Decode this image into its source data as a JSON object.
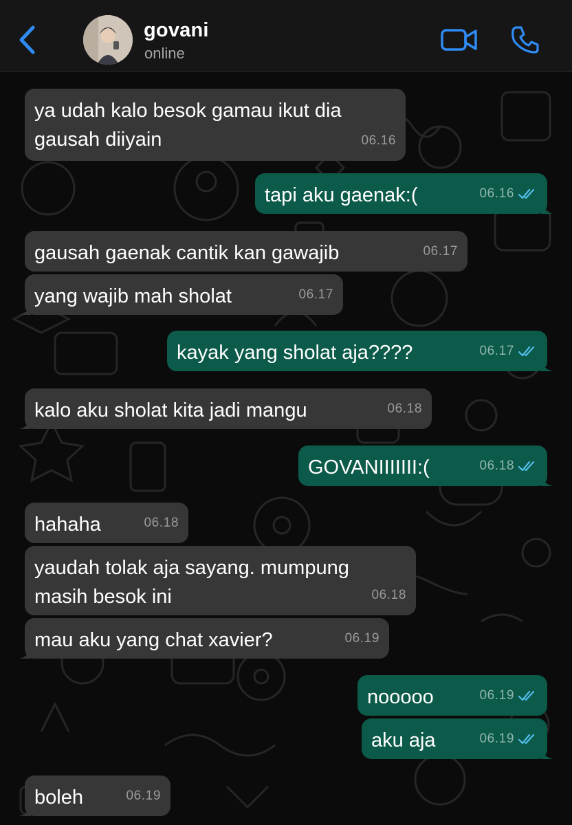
{
  "header": {
    "name": "govani",
    "status": "online"
  },
  "colors": {
    "accent": "#2f8cf5",
    "incoming_bubble": "#373737",
    "outgoing_bubble": "#0c5a49",
    "read_ticks": "#53bdeb"
  },
  "icons": {
    "back": "chevron-left-icon",
    "video": "video-camera-icon",
    "call": "phone-icon",
    "read": "double-check-icon"
  },
  "messages": [
    {
      "dir": "in",
      "lines": [
        "ya udah kalo besok gamau ikut dia",
        "gausah diiyain"
      ],
      "time": "06.16"
    },
    {
      "dir": "out",
      "lines": [
        "tapi aku gaenak:("
      ],
      "time": "06.16",
      "read": true
    },
    {
      "dir": "in",
      "lines": [
        "gausah gaenak cantik kan gawajib"
      ],
      "time": "06.17"
    },
    {
      "dir": "in",
      "lines": [
        "yang wajib mah sholat"
      ],
      "time": "06.17"
    },
    {
      "dir": "out",
      "lines": [
        "kayak yang sholat aja????"
      ],
      "time": "06.17",
      "read": true
    },
    {
      "dir": "in",
      "lines": [
        "kalo aku sholat kita jadi mangu"
      ],
      "time": "06.18"
    },
    {
      "dir": "out",
      "lines": [
        "GOVANIIIIIII:("
      ],
      "time": "06.18",
      "read": true
    },
    {
      "dir": "in",
      "lines": [
        "hahaha"
      ],
      "time": "06.18"
    },
    {
      "dir": "in",
      "lines": [
        "yaudah tolak aja sayang. mumpung",
        "masih besok ini"
      ],
      "time": "06.18"
    },
    {
      "dir": "in",
      "lines": [
        "mau aku yang chat xavier?"
      ],
      "time": "06.19"
    },
    {
      "dir": "out",
      "lines": [
        "nooooo"
      ],
      "time": "06.19",
      "read": true
    },
    {
      "dir": "out",
      "lines": [
        "aku aja"
      ],
      "time": "06.19",
      "read": true
    },
    {
      "dir": "in",
      "lines": [
        "boleh"
      ],
      "time": "06.19"
    }
  ]
}
